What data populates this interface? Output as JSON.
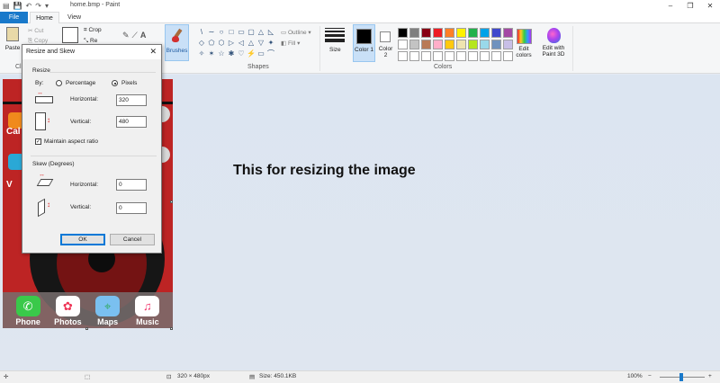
{
  "window": {
    "title": "home.bmp - Paint",
    "controls": [
      "–",
      "❐",
      "✕"
    ]
  },
  "quick_access": [
    "save-icon",
    "undo-icon",
    "redo-icon",
    "customize-icon"
  ],
  "tabs": [
    {
      "label": "File"
    },
    {
      "label": "Home"
    },
    {
      "label": "View"
    }
  ],
  "ribbon": {
    "clipboard": {
      "paste": "Paste",
      "cut": "Cut",
      "copy": "Copy",
      "label": "Cl"
    },
    "image": {
      "crop": "Crop",
      "resize": "Re"
    },
    "brushes": "Brushes",
    "shapes": {
      "label": "Shapes",
      "outline": "Outline",
      "fill": "Fill"
    },
    "size": "Size",
    "color1": "Color 1",
    "color2": "Color 2",
    "colors_label": "Colors",
    "edit_colors": "Edit colors",
    "paint3d": "Edit with Paint 3D",
    "palette": [
      "#000000",
      "#7f7f7f",
      "#880015",
      "#ed1c24",
      "#ff7f27",
      "#fff200",
      "#22b14c",
      "#00a2e8",
      "#3f48cc",
      "#a349a4",
      "#ffffff",
      "#c3c3c3",
      "#b97a57",
      "#ffaec9",
      "#ffc90e",
      "#efe4b0",
      "#b5e61d",
      "#99d9ea",
      "#7092be",
      "#c8bfe7",
      "#ffffff",
      "#ffffff",
      "#ffffff",
      "#ffffff",
      "#ffffff",
      "#ffffff",
      "#ffffff",
      "#ffffff",
      "#ffffff",
      "#ffffff"
    ],
    "shape_icons": [
      "\\",
      "∼",
      "○",
      "□",
      "▭",
      "▢",
      "△",
      "◺",
      "◇",
      "⬠",
      "⬡",
      "▷",
      "◁",
      "△",
      "▽",
      "✦",
      "✧",
      "✶",
      "☆",
      "✱",
      "♡",
      "⚡",
      "▭",
      "⌒"
    ]
  },
  "image": {
    "side_labels": [
      "Cal",
      "V"
    ],
    "dock": [
      {
        "label": "Phone",
        "color": "#3ac94a"
      },
      {
        "label": "Photos",
        "color": "#ffffff"
      },
      {
        "label": "Maps",
        "color": "#7ac0f0"
      },
      {
        "label": "Music",
        "color": "#ffffff"
      }
    ]
  },
  "annotation": "This for resizing the image",
  "dialog": {
    "title": "Resize and Skew",
    "close": "✕",
    "resize_section": "Resize",
    "by_label": "By:",
    "percentage": "Percentage",
    "pixels": "Pixels",
    "horizontal_label": "Horizontal:",
    "vertical_label": "Vertical:",
    "resize_horizontal": "320",
    "resize_vertical": "480",
    "maintain_aspect": "Maintain aspect ratio",
    "skew_section": "Skew (Degrees)",
    "skew_horizontal": "0",
    "skew_vertical": "0",
    "ok": "OK",
    "cancel": "Cancel"
  },
  "statusbar": {
    "dimensions": "320 × 480px",
    "size": "Size: 450.1KB",
    "zoom": "100%",
    "zoom_minus": "−",
    "zoom_plus": "+"
  }
}
